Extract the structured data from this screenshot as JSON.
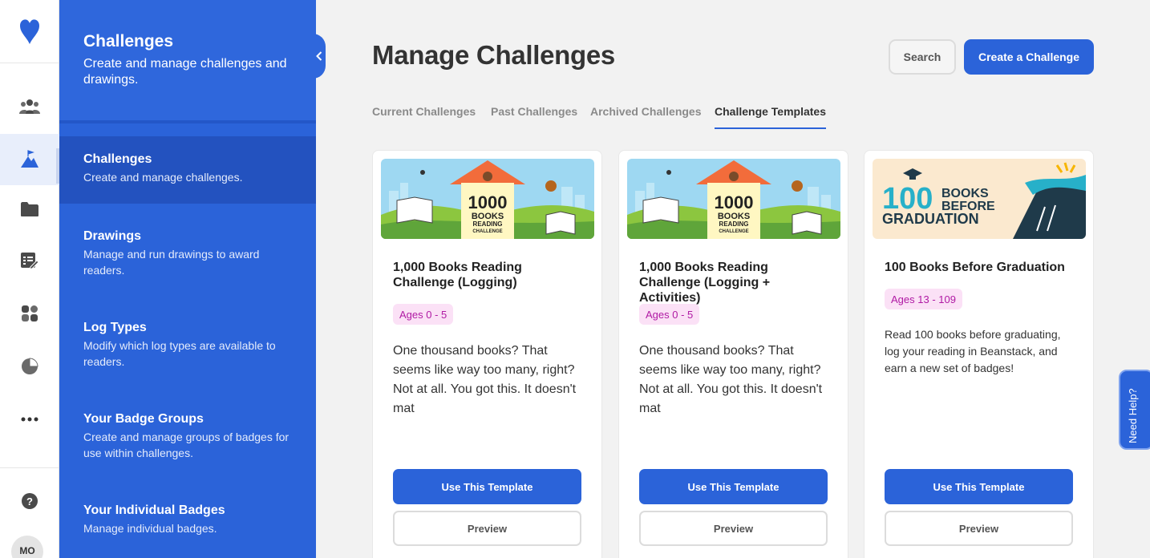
{
  "rail": {
    "items": [
      {
        "icon": "logo-heart-icon"
      },
      {
        "icon": "people-icon"
      },
      {
        "icon": "challenges-mountain-icon"
      },
      {
        "icon": "folder-icon"
      },
      {
        "icon": "list-edit-icon"
      },
      {
        "icon": "grid-icon"
      },
      {
        "icon": "pie-chart-icon"
      },
      {
        "icon": "more-icon"
      },
      {
        "icon": "help-icon"
      }
    ],
    "avatar": "MO"
  },
  "subnav": {
    "title": "Challenges",
    "subtitle": "Create and manage challenges and drawings.",
    "items": [
      {
        "title": "Challenges",
        "desc": "Create and manage challenges."
      },
      {
        "title": "Drawings",
        "desc": "Manage and run drawings to award readers."
      },
      {
        "title": "Log Types",
        "desc": "Modify which log types are available to readers."
      },
      {
        "title": "Your Badge Groups",
        "desc": "Create and manage groups of badges for use within challenges."
      },
      {
        "title": "Your Individual Badges",
        "desc": "Manage individual badges."
      }
    ]
  },
  "header": {
    "title": "Manage Challenges",
    "search_label": "Search",
    "create_label": "Create a Challenge"
  },
  "tabs": [
    {
      "label": "Current Challenges"
    },
    {
      "label": "Past Challenges"
    },
    {
      "label": "Archived Challenges"
    },
    {
      "label": "Challenge Templates",
      "active": true
    }
  ],
  "cards": [
    {
      "banner": {
        "big": "1000",
        "mid": "BOOKS",
        "small1": "READING",
        "small2": "CHALLENGE"
      },
      "title": "1,000 Books Reading Challenge (Logging)",
      "ages": "Ages 0 - 5",
      "desc": "One thousand books? That seems like way too many, right? Not at all. You got this. It doesn't mat",
      "use_label": "Use This Template",
      "preview_label": "Preview"
    },
    {
      "banner": {
        "big": "1000",
        "mid": "BOOKS",
        "small1": "READING",
        "small2": "CHALLENGE"
      },
      "title": "1,000 Books Reading Challenge (Logging + Activities)",
      "ages": "Ages 0 - 5",
      "desc": "One thousand books? That seems like way too many, right? Not at all. You got this. It doesn't mat",
      "use_label": "Use This Template",
      "preview_label": "Preview"
    },
    {
      "banner": {
        "big": "100",
        "line1": "BOOKS",
        "line2": "BEFORE",
        "line3": "GRADUATION"
      },
      "title": "100 Books Before Graduation",
      "ages": "Ages 13 - 109",
      "desc": "Read 100 books before graduating, log your reading in Beanstack, and earn a new set of badges!",
      "use_label": "Use This Template",
      "preview_label": "Preview"
    }
  ],
  "help": {
    "label": "Need Help?"
  },
  "colors": {
    "brand": "#2b63d9",
    "badge_bg": "#fbe1f6",
    "badge_text": "#b01aa4"
  }
}
